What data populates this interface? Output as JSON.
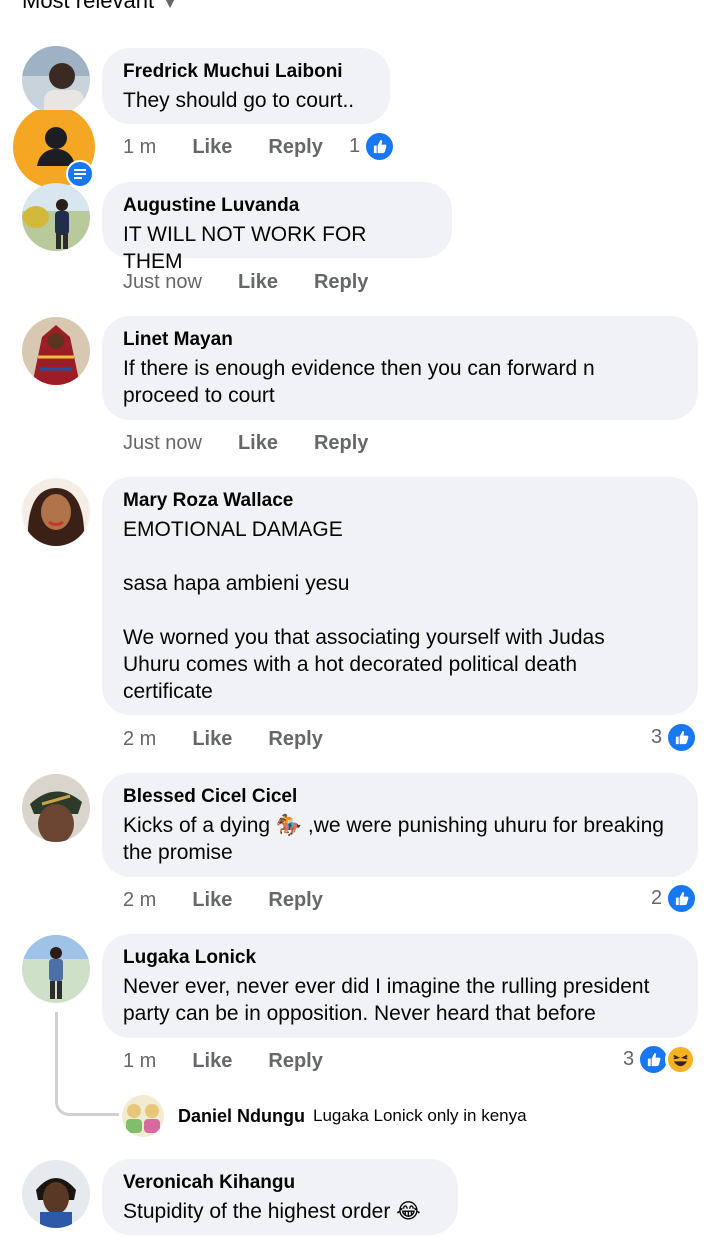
{
  "header": {
    "sort_label": "Most relevant"
  },
  "comments": [
    {
      "author": "Fredrick Muchui Laiboni",
      "text": "They should go to court..",
      "time": "1 m",
      "like": "Like",
      "reply": "Reply",
      "reaction_count": "1"
    },
    {
      "author": "Augustine Luvanda",
      "text": "IT WILL NOT WORK FOR THEM",
      "time": "Just now",
      "like": "Like",
      "reply": "Reply"
    },
    {
      "author": "Linet Mayan",
      "text": "If there is enough evidence then you can forward n\nproceed to court",
      "time": "Just now",
      "like": "Like",
      "reply": "Reply"
    },
    {
      "author": "Mary Roza Wallace",
      "text": "EMOTIONAL DAMAGE\n\nsasa hapa ambieni yesu\n\nWe worned you that associating yourself with Judas\nUhuru comes with a hot decorated political death\ncertificate",
      "time": "2 m",
      "like": "Like",
      "reply": "Reply",
      "reaction_count": "3"
    },
    {
      "author": "Blessed Cicel Cicel",
      "text_before": "Kicks of a dying ",
      "emoji": "🏇",
      "text_after": " ,we were punishing uhuru for breaking\nthe promise",
      "time": "2 m",
      "like": "Like",
      "reply": "Reply",
      "reaction_count": "2"
    },
    {
      "author": "Lugaka Lonick",
      "text": "Never ever, never ever did I imagine the rulling president\nparty can be in opposition. Never heard that before",
      "time": "1 m",
      "like": "Like",
      "reply": "Reply",
      "reaction_count": "3"
    },
    {
      "author": "Veronicah Kihangu",
      "text": "Stupidity of the highest order ",
      "emoji": "😂"
    }
  ],
  "reply_preview": {
    "author": "Daniel Ndungu",
    "text": "Lugaka Lonick only in kenya"
  },
  "colors": {
    "bubble": "#f0f2f5",
    "like_blue": "#1877f2",
    "meta_gray": "#65676b",
    "chat_head_orange": "#f5a623"
  },
  "icons": [
    "chevron-down-icon",
    "like-reaction-icon",
    "haha-reaction-icon",
    "person-icon",
    "messenger-badge-icon"
  ]
}
